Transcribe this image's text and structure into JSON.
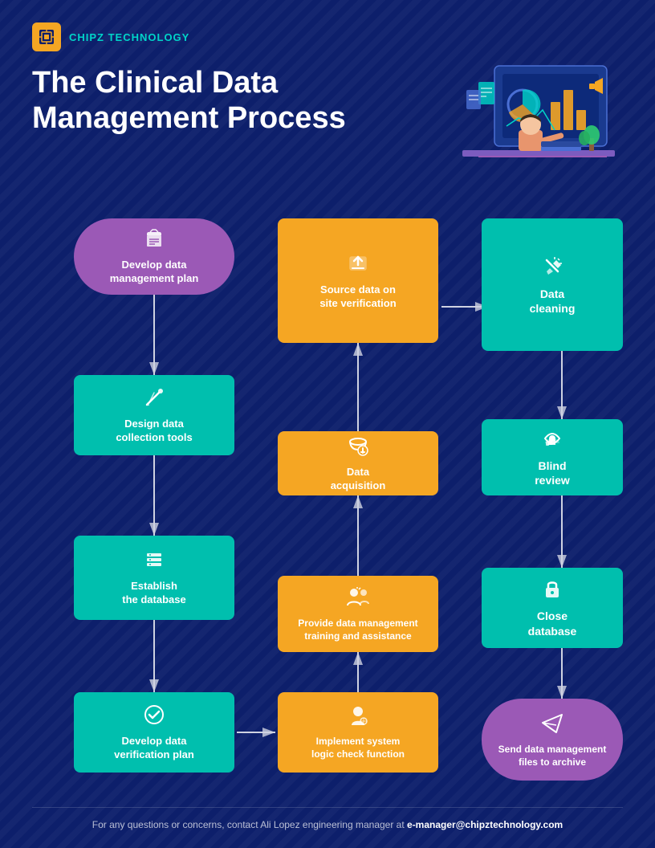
{
  "brand": {
    "name": "CHIPZ TECHNOLOGY"
  },
  "title": "The Clinical Data Management Process",
  "boxes": {
    "develop_plan": {
      "label": "Develop data\nmanagement plan",
      "icon": "📁"
    },
    "design_tools": {
      "label": "Design data\ncollection tools",
      "icon": "✏️"
    },
    "establish_db": {
      "label": "Establish\nthe database",
      "icon": "📋"
    },
    "develop_verification": {
      "label": "Develop data\nverification plan",
      "icon": "✔️"
    },
    "source_data": {
      "label": "Source data on\nsite verification",
      "icon": "⬆️"
    },
    "data_acquisition": {
      "label": "Data\nacquisition",
      "icon": "🗄️"
    },
    "provide_training": {
      "label": "Provide data management\ntraining and assistance",
      "icon": "👥"
    },
    "implement_logic": {
      "label": "Implement system\nlogic check function",
      "icon": "👤"
    },
    "data_cleaning": {
      "label": "Data\ncleaning",
      "icon": "🧹"
    },
    "blind_review": {
      "label": "Blind\nreview",
      "icon": "👍"
    },
    "close_database": {
      "label": "Close\ndatabase",
      "icon": "🔒"
    },
    "send_archive": {
      "label": "Send data management\nfiles to archive",
      "icon": "✈️"
    }
  },
  "footer": {
    "text": "For any questions or concerns, contact Ali Lopez engineering manager at ",
    "email": "e-manager@chipztechnology.com"
  }
}
